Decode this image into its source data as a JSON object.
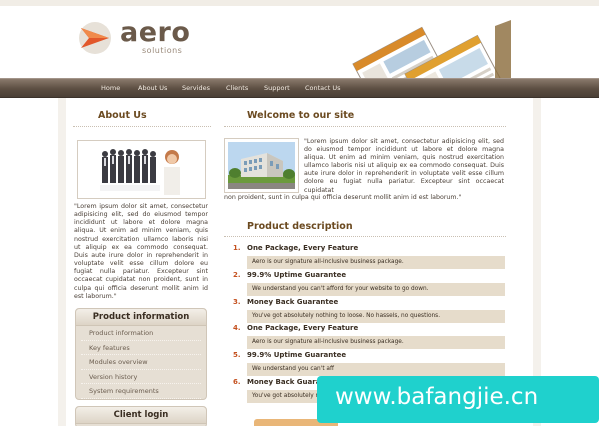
{
  "brand": {
    "name": "aero",
    "tagline": "solutions"
  },
  "nav": {
    "items": [
      "Home",
      "About Us",
      "Servides",
      "Clients",
      "Support",
      "Contact Us"
    ]
  },
  "about": {
    "title": "About Us",
    "text": "\"Lorem ipsum dolor sit amet, consectetur adipisicing elit, sed do eiusmod tempor incididunt ut labore et dolore magna aliqua. Ut enim ad minim veniam, quis nostrud exercitation ullamco laboris nisi ut aliquip ex ea commodo consequat. Duis aute irure dolor in reprehenderit in voluptate velit esse cillum dolore eu fugiat nulla pariatur. Excepteur sint occaecat cupidatat non proident, sunt in culpa qui officia deserunt mollit anim id est laborum.\""
  },
  "product_panel": {
    "title": "Product information",
    "items": [
      "Product information",
      "Key features",
      "Modules overview",
      "Version history",
      "System requirements"
    ]
  },
  "client_panel": {
    "title": "Client login"
  },
  "welcome": {
    "title": "Welcome to our site",
    "text": "\"Lorem ipsum dolor sit amet, consectetur adipisicing elit, sed do eiusmod tempor incididunt ut labore et dolore magna aliqua. Ut enim ad minim veniam, quis nostrud exercitation ullamco laboris nisi ut aliquip ex ea commodo consequat. Duis aute irure dolor in reprehenderit in voluptate velit esse cillum dolore eu fugiat nulla pariatur. Excepteur sint occaecat cupidatat",
    "tail": "non proident, sunt in culpa qui officia deserunt mollit anim id est laborum.\""
  },
  "product_desc": {
    "title": "Product description",
    "items": [
      {
        "num": "1.",
        "head": "One Package, Every Feature",
        "desc": "Aero is our signature all-inclusive business package."
      },
      {
        "num": "2.",
        "head": "99.9% Uptime Guarantee",
        "desc": "We understand you can't afford for your website to go down."
      },
      {
        "num": "3.",
        "head": "Money Back Guarantee",
        "desc": "You've got absolutely nothing to loose. No hassels, no questions."
      },
      {
        "num": "4.",
        "head": "One Package, Every Feature",
        "desc": "Aero is our signature all-inclusive business package."
      },
      {
        "num": "5.",
        "head": "99.9% Uptime Guarantee",
        "desc": "We understand you can't aff"
      },
      {
        "num": "6.",
        "head": "Money Back Guarantee",
        "desc": "You've got absolutely noth"
      }
    ]
  },
  "watermark": {
    "text": "www.bafangjie.cn"
  },
  "colors": {
    "accent": "#c4501e",
    "heading": "#6b4a20",
    "nav": "#5c4e42",
    "bar": "#e6dccb",
    "watermark": "#1fd1cd"
  }
}
